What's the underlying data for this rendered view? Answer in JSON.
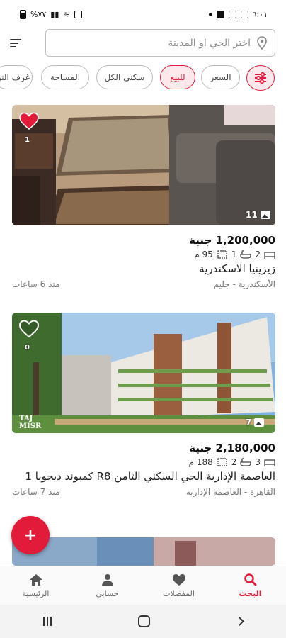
{
  "status_bar": {
    "time": "٦:٠١",
    "battery": "%٧٧"
  },
  "search": {
    "placeholder": "اختر الحي او المدينة"
  },
  "filters": {
    "chips": [
      "غرف النو",
      "المساحة",
      "سكنى الكل",
      "للبيع",
      "السعر"
    ]
  },
  "listings": [
    {
      "favorites_count": "1",
      "photo_count": "11",
      "price": "1,200,000 جنية",
      "bedrooms": "2",
      "bathrooms": "1",
      "area": "95 م",
      "title": "زيزينيا الاسكندرية",
      "location": "الأسكندرية - جليم",
      "time_ago": "منذ 6 ساعات",
      "favorited": true
    },
    {
      "favorites_count": "0",
      "photo_count": "7",
      "watermark_top": "TAJ",
      "watermark_bottom": "MISR",
      "price": "2,180,000 جنية",
      "bedrooms": "3",
      "bathrooms": "2",
      "area": "188 م",
      "title": "العاصمة الإدارية الحي السكني الثامن R8 كمبوند ديجويا 1",
      "location": "القاهرة - العاصمة الإدارية",
      "time_ago": "منذ 7 ساعات",
      "favorited": false
    }
  ],
  "fab": {
    "label": "+"
  },
  "bottom_nav": {
    "items": [
      {
        "label": "الرئيسية",
        "icon": "home-icon"
      },
      {
        "label": "حسابي",
        "icon": "person-icon"
      },
      {
        "label": "المفضلات",
        "icon": "heart-icon"
      },
      {
        "label": "البحث",
        "icon": "search-icon"
      }
    ]
  },
  "colors": {
    "accent": "#e31b3a"
  }
}
